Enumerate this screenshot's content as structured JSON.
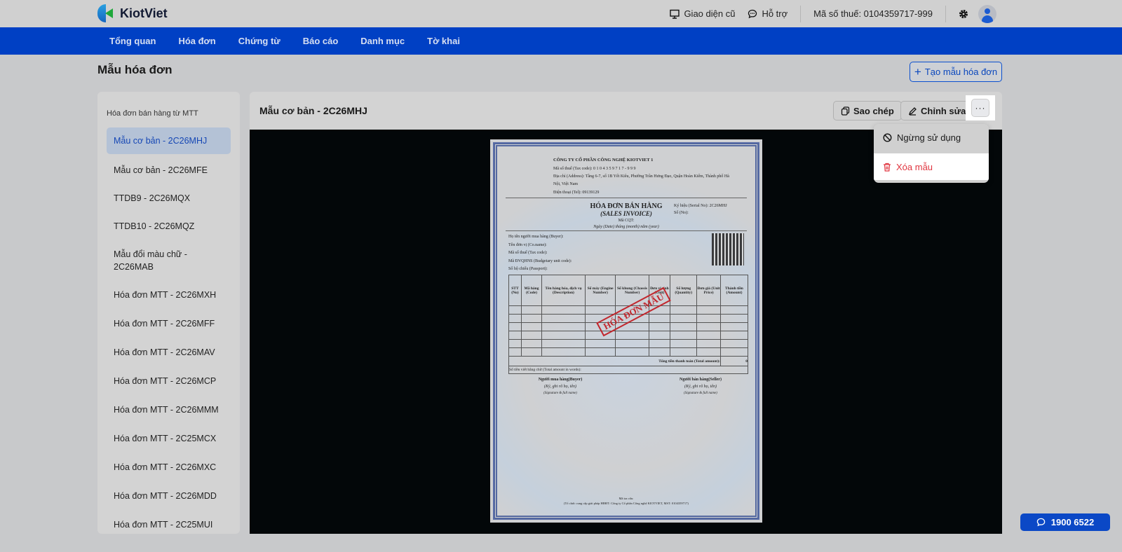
{
  "brand": {
    "name": "KiotViet"
  },
  "topbar": {
    "old_ui": "Giao diện cũ",
    "support": "Hỗ trợ",
    "tax_code": "Mã số thuế: 0104359717-999"
  },
  "nav": [
    "Tổng quan",
    "Hóa đơn",
    "Chứng từ",
    "Báo cáo",
    "Danh mục",
    "Tờ khai"
  ],
  "page": {
    "title": "Mẫu hóa đơn",
    "create_label": "Tạo mẫu hóa đơn"
  },
  "sidebar": {
    "heading": "Hóa đơn bán hàng từ MTT",
    "items": [
      "Mẫu cơ bản - 2C26MHJ",
      "Mẫu cơ bản - 2C26MFE",
      "TTDB9 - 2C26MQX",
      "TTDB10 - 2C26MQZ",
      "Mẫu đổi màu chữ - 2C26MAB",
      "Hóa đơn MTT - 2C26MXH",
      "Hóa đơn MTT - 2C26MFF",
      "Hóa đơn MTT - 2C26MAV",
      "Hóa đơn MTT - 2C26MCP",
      "Hóa đơn MTT - 2C26MMM",
      "Hóa đơn MTT - 2C25MCX",
      "Hóa đơn MTT - 2C26MXC",
      "Hóa đơn MTT - 2C26MDD",
      "Hóa đơn MTT - 2C25MUI"
    ],
    "selected": 0
  },
  "main": {
    "title": "Mẫu cơ bản - 2C26MHJ",
    "copy_label": "Sao chép",
    "edit_label": "Chỉnh sửa",
    "more_label": "···"
  },
  "menu": {
    "disable": "Ngừng sử dụng",
    "delete": "Xóa mẫu"
  },
  "invoice": {
    "company": "CÔNG TY CỔ PHẦN CÔNG NGHỆ KIOTVIET 1",
    "tax": "Mã số thuế (Tax code): 0 1 0 4 3 5 9 7 1 7 - 9 9 9",
    "address": "Địa chỉ (Address): Tầng 6-7, số 1B Yết Kiêu, Phường Trần Hưng Đạo, Quận Hoàn Kiếm, Thành phố Hà Nội, Việt Nam",
    "phone": "Điện thoại (Tel): 09139129",
    "title": "HÓA ĐƠN BÁN HÀNG",
    "subtitle": "(SALES INVOICE)",
    "cqt": "Mã CQT:",
    "date": "Ngày (Date) tháng (month) năm (year)",
    "serial": "Ký hiệu (Serial No): 2C26MHJ",
    "number": "Số (No):",
    "buyer_fields": [
      "Họ tên người mua hàng (Buyer):",
      "Tên đơn vị (Co.name):",
      "Mã số thuế (Tax code):",
      "Mã ĐVQHNS (Budgetary unit code):",
      "Số hộ chiếu (Passport):"
    ],
    "columns": [
      "STT (No)",
      "Mã hàng (Code)",
      "Tên hàng hóa, dịch vụ (Description)",
      "Số máy (Engine Number)",
      "Số khung (Chassis Number)",
      "Đơn vị tính (Unit)",
      "Số lượng (Quantity)",
      "Đơn giá (Unit Price)",
      "Thành tiền (Amount)"
    ],
    "total_label": "Tổng tiền thanh toán (Total amount):",
    "total_value": "0",
    "words_label": "Số tiền viết bằng chữ (Total amount in words):",
    "stamp": "HÓA ĐƠN MẪU",
    "buyer_sign": [
      "Người mua hàng(Buyer)",
      "(Ký, ghi rõ họ, tên)",
      "(Signature & full name)"
    ],
    "seller_sign": [
      "Người bán hàng(Seller)",
      "(Ký, ghi rõ họ, tên)",
      "(Signature & full name)"
    ],
    "lookup": "Mã tra cứu:",
    "provider": "(Tổ chức cung cấp giải pháp HĐĐT: Công ty Cổ phần Công nghệ KIOTVIET, MST: 0104359717)"
  },
  "hotline": "1900 6522"
}
